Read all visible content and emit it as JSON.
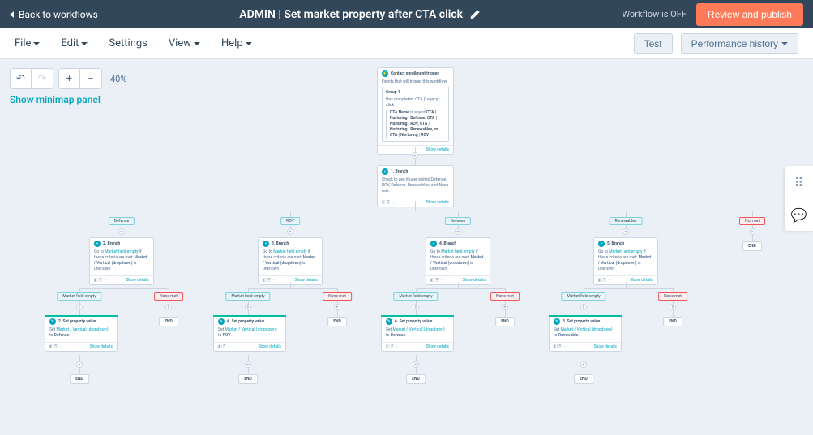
{
  "header": {
    "back": "Back to workflows",
    "title": "ADMIN | Set market property after CTA click",
    "status": "Workflow is OFF",
    "publish": "Review and publish"
  },
  "toolbar": {
    "items": [
      "File",
      "Edit",
      "Settings",
      "View",
      "Help"
    ],
    "test": "Test",
    "history": "Performance history"
  },
  "controls": {
    "zoom": "40%",
    "minimap": "Show minimap panel"
  },
  "trigger": {
    "title": "Contact enrollment trigger",
    "subtitle": "Events that will trigger this workflow",
    "group_label": "Group 1",
    "line1": "Has completed: CTA (Legacy): click",
    "criteria_label": "CTA Name",
    "criteria_op": "is any of",
    "criteria_val": "CTA | Nurturing | Defense, CTA | Nurturing | ROV, CTA | Nurturing | Renewables, or CTA | Nurturing | ROV",
    "show": "Show details"
  },
  "branch1": {
    "step": "1. Branch",
    "body": "Check to see if user visited Defense, ROV, Defense, Renewables, and None met.",
    "show": "Show details"
  },
  "branches": {
    "defense": "Defense",
    "rov": "ROV",
    "defense2": "Defense",
    "renewables": "Renewables",
    "none": "Not met"
  },
  "sub_branch": {
    "step2": "2. Branch",
    "step3": "3. Branch",
    "step4": "4. Branch",
    "step5": "5. Branch",
    "body_prefix": "Go to",
    "body_link": "Market field empty",
    "body_suffix": "if these criteria are met:",
    "prop": "Market / Vertical (dropdown)",
    "val": "is unknown",
    "show": "Show details"
  },
  "sub_labels": {
    "empty": "Market field empty",
    "none": "None met"
  },
  "set_prop": {
    "step2": "2. Set property value",
    "step4": "4. Set property value",
    "step6": "6. Set property value",
    "step8": "8. Set property value",
    "prefix": "Set",
    "prop": "Market / Vertical (dropdown)",
    "to": "to",
    "v_defense": "Defense",
    "v_rov": "ROV",
    "v_renewable": "Renewable",
    "show": "Show details"
  },
  "end": "END"
}
